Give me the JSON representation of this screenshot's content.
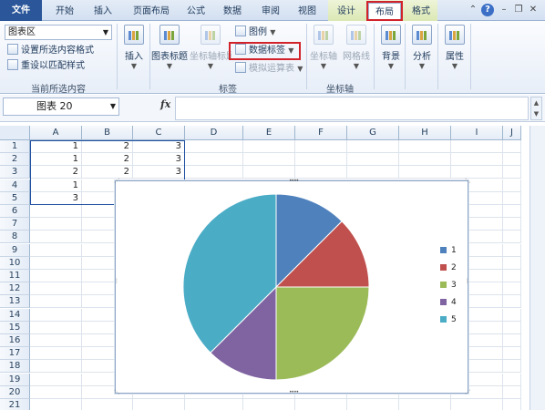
{
  "tabs": {
    "file": "文件",
    "items": [
      {
        "label": "开始"
      },
      {
        "label": "插入"
      },
      {
        "label": "页面布局"
      },
      {
        "label": "公式"
      },
      {
        "label": "数据"
      },
      {
        "label": "审阅"
      },
      {
        "label": "视图"
      }
    ],
    "context": [
      {
        "label": "设计"
      },
      {
        "label": "布局",
        "active": true
      },
      {
        "label": "格式"
      }
    ]
  },
  "ribbon": {
    "current_selection": {
      "select_value": "图表区",
      "format_selection": "设置所选内容格式",
      "reset_style": "重设以匹配样式",
      "group_label": "当前所选内容"
    },
    "insert": {
      "label": "插入"
    },
    "labels_group": {
      "chart_title": "图表标题",
      "axis_titles": "坐标轴标题",
      "legend": "图例",
      "data_labels": "数据标签",
      "data_table": "模拟运算表",
      "group_label": "标签"
    },
    "axes_group": {
      "axes": "坐标轴",
      "gridlines": "网格线",
      "group_label": "坐标轴"
    },
    "background": {
      "label": "背景"
    },
    "analysis": {
      "label": "分析"
    },
    "properties": {
      "label": "属性"
    }
  },
  "formula_bar": {
    "name_box": "图表 20",
    "fx": "fx",
    "formula": ""
  },
  "sheet": {
    "columns": [
      "A",
      "B",
      "C",
      "D",
      "E",
      "F",
      "G",
      "H",
      "I",
      "J"
    ],
    "rows": [
      "1",
      "2",
      "3",
      "4",
      "5",
      "6",
      "7",
      "8",
      "9",
      "10",
      "11",
      "12",
      "13",
      "14",
      "15",
      "16",
      "17",
      "18",
      "19",
      "20",
      "21"
    ],
    "cells": [
      [
        "1",
        "2",
        "3"
      ],
      [
        "1",
        "2",
        "3"
      ],
      [
        "2",
        "2",
        "3"
      ],
      [
        "1",
        "",
        ""
      ],
      [
        "3",
        "",
        ""
      ]
    ]
  },
  "chart_data": {
    "type": "pie",
    "categories": [
      "1",
      "2",
      "3",
      "4",
      "5"
    ],
    "values": [
      1,
      1,
      2,
      1,
      3
    ],
    "colors": [
      "#4f81bd",
      "#c0504d",
      "#9bbb59",
      "#8064a2",
      "#4bacc6"
    ],
    "legend_position": "right"
  }
}
